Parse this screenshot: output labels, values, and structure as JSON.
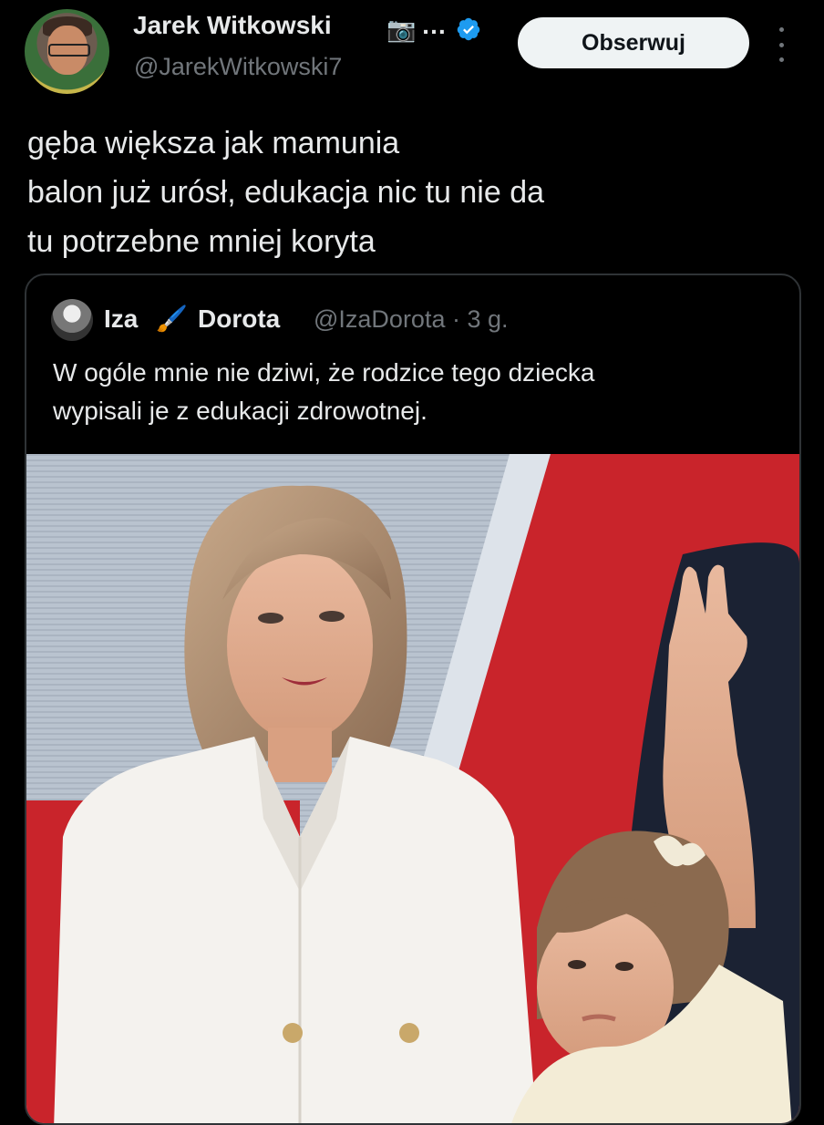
{
  "author": {
    "name": "Jarek Witkowski",
    "name_suffix": "…",
    "camera_emoji": "📷",
    "handle": "@JarekWitkowski7",
    "verified": true
  },
  "follow_button": {
    "label": "Obserwuj"
  },
  "tweet": {
    "lines": [
      "gęba większa jak mamunia",
      "balon już urósł, edukacja nic tu nie da",
      "tu potrzebne mniej koryta"
    ]
  },
  "quoted": {
    "name_first": "Iza",
    "brush_emoji": "🖌️",
    "name_second": "Dorota",
    "handle_time": "@IzaDorota · 3 g.",
    "lines": [
      "W ogóle mnie nie dziwi, że rodzice tego dziecka",
      "wypisali je z edukacji zdrowotnej."
    ]
  },
  "colors": {
    "background": "#000000",
    "text": "#e7e9ea",
    "muted": "#71767b",
    "verified": "#1d9bf0",
    "border": "#2f3336"
  },
  "icons": [
    "camera-icon",
    "verified-icon",
    "more-icon",
    "brush-icon"
  ]
}
